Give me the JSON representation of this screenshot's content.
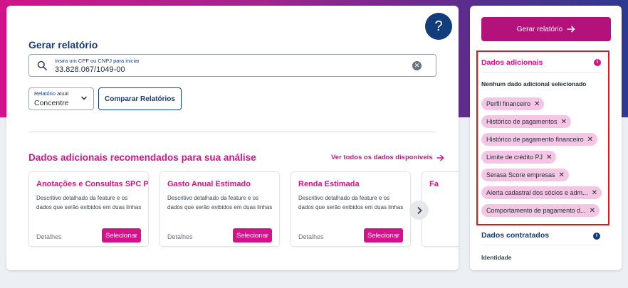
{
  "help": {
    "label": "?"
  },
  "report": {
    "title": "Gerar relatório",
    "search": {
      "label": "Insira um CPF ou CNPJ para iniciar",
      "value": "33.828.067/1049-00"
    },
    "current_report": {
      "label": "Relatório atual",
      "value": "Concentre"
    },
    "compare_label": "Comparar Relatórios"
  },
  "recommended": {
    "title": "Dados adicionais recomendados para sua análise",
    "see_all": "Ver todos os dados disponíveis",
    "cards": [
      {
        "name": "Anotações e Consultas SPC PJ",
        "description": "Descritivo detalhado da feature e os dados que serão exibidos em duas linhas",
        "details": "Detalhes",
        "select": "Selecionar"
      },
      {
        "name": "Gasto Anual Estimado",
        "description": "Descritivo detalhado da feature e os dados que serão exibidos em duas linhas",
        "details": "Detalhes",
        "select": "Selecionar"
      },
      {
        "name": "Renda Estimada",
        "description": "Descritivo detalhado da feature e os dados que serão exibidos em duas linhas",
        "details": "Detalhes",
        "select": "Selecionar"
      },
      {
        "name": "Fa",
        "description": "",
        "details": "",
        "select": ""
      }
    ]
  },
  "sidebar": {
    "generate_label": "Gerar relatório",
    "additional": {
      "title": "Dados adicionais",
      "info": "i",
      "empty_text": "Nenhum dado adicional selecionado",
      "chips": [
        "Perfil financeiro",
        "Histórico de pagamentos",
        "Histórico de pagamento financeiro",
        "Limite de crédito PJ",
        "Serasa Score empresas",
        "Alerta cadastral dos sócios e adm...",
        "Comportamento de pagamento d..."
      ],
      "remove_symbol": "✕"
    },
    "contracted": {
      "title": "Dados contratados",
      "info": "i",
      "items": [
        "Identidade"
      ]
    }
  },
  "colors": {
    "brand_pink": "#d3138a",
    "brand_blue": "#123c7c",
    "highlight_border": "#e3161d",
    "chip_bg": "#f5c6e3"
  }
}
